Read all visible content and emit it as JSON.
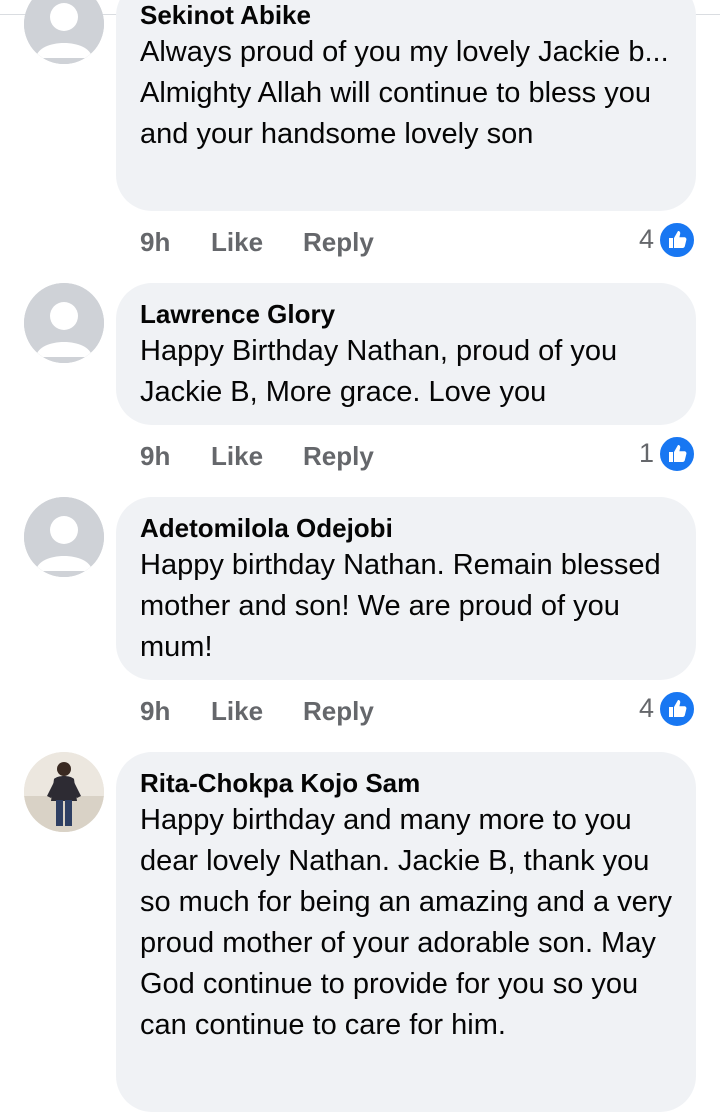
{
  "comments": [
    {
      "author": "Sekinot Abike",
      "text": "Always proud of you my lovely Jackie b... Almighty Allah will continue to bless you and your handsome lovely son",
      "time": "9h",
      "like_label": "Like",
      "reply_label": "Reply",
      "reaction_count": "4",
      "avatar": "default-avatar"
    },
    {
      "author": "Lawrence Glory",
      "text": "Happy Birthday Nathan, proud of you Jackie B, More grace. Love you",
      "time": "9h",
      "like_label": "Like",
      "reply_label": "Reply",
      "reaction_count": "1",
      "avatar": "default-avatar"
    },
    {
      "author": "Adetomilola Odejobi",
      "text": "Happy birthday Nathan. Remain blessed mother and son! We are proud of you mum!",
      "time": "9h",
      "like_label": "Like",
      "reply_label": "Reply",
      "reaction_count": "4",
      "avatar": "default-avatar"
    },
    {
      "author": "Rita-Chokpa Kojo Sam",
      "text": "Happy birthday and many more to you dear lovely Nathan. Jackie B, thank you so much for being an amazing and a very proud mother of your adorable son. May God continue to provide for you so you can continue to care for him.",
      "avatar": "profile-photo"
    }
  ],
  "colors": {
    "bubble": "#f0f2f5",
    "meta_text": "#65676b",
    "like_badge": "#1877f2"
  }
}
